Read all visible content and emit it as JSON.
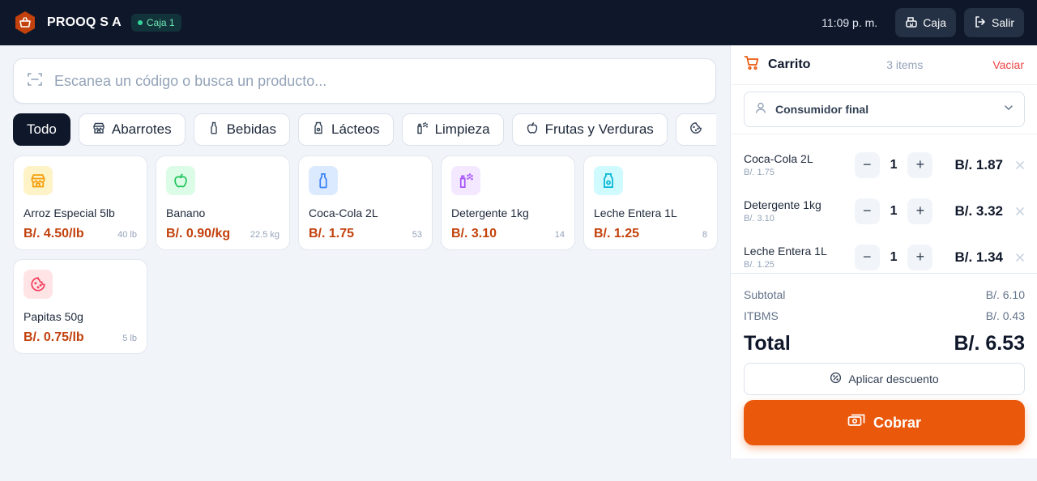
{
  "header": {
    "brand": "PROOQ S A",
    "register": "Caja 1",
    "time": "11:09 p. m.",
    "cash_label": "Caja",
    "logout_label": "Salir"
  },
  "search": {
    "placeholder": "Escanea un código o busca un producto..."
  },
  "categories": [
    {
      "label": "Todo",
      "icon": "none",
      "active": true
    },
    {
      "label": "Abarrotes",
      "icon": "store-icon"
    },
    {
      "label": "Bebidas",
      "icon": "bottle-icon"
    },
    {
      "label": "Lácteos",
      "icon": "milk-icon"
    },
    {
      "label": "Limpieza",
      "icon": "spray-icon"
    },
    {
      "label": "Frutas y Verduras",
      "icon": "apple-icon"
    },
    {
      "label": "",
      "icon": "cookie-icon"
    }
  ],
  "products": [
    {
      "name": "Arroz Especial 5lb",
      "price": "B/. 4.50/lb",
      "stock": "40 lb",
      "icon": "store-icon",
      "tint": "#fef3c7",
      "color": "#f59e0b"
    },
    {
      "name": "Banano",
      "price": "B/. 0.90/kg",
      "stock": "22.5 kg",
      "icon": "apple-icon",
      "tint": "#dcfce7",
      "color": "#22c55e"
    },
    {
      "name": "Coca-Cola 2L",
      "price": "B/. 1.75",
      "stock": "53",
      "icon": "bottle-icon",
      "tint": "#dbeafe",
      "color": "#3b82f6"
    },
    {
      "name": "Detergente 1kg",
      "price": "B/. 3.10",
      "stock": "14",
      "icon": "spray-icon",
      "tint": "#f3e8ff",
      "color": "#a855f7"
    },
    {
      "name": "Leche Entera 1L",
      "price": "B/. 1.25",
      "stock": "8",
      "icon": "milk-icon",
      "tint": "#cffafe",
      "color": "#06b6d4"
    },
    {
      "name": "Papitas 50g",
      "price": "B/. 0.75/lb",
      "stock": "5 lb",
      "icon": "cookie-icon",
      "tint": "#ffe4e6",
      "color": "#f43f5e"
    }
  ],
  "cart": {
    "title": "Carrito",
    "count": "3 items",
    "clear_label": "Vaciar",
    "customer": "Consumidor final",
    "items": [
      {
        "name": "Coca-Cola 2L",
        "unit": "B/. 1.75",
        "qty": "1",
        "total": "B/. 1.87"
      },
      {
        "name": "Detergente 1kg",
        "unit": "B/. 3.10",
        "qty": "1",
        "total": "B/. 3.32"
      },
      {
        "name": "Leche Entera 1L",
        "unit": "B/. 1.25",
        "qty": "1",
        "total": "B/. 1.34"
      }
    ],
    "subtotal_label": "Subtotal",
    "subtotal": "B/. 6.10",
    "tax_label": "ITBMS",
    "tax": "B/. 0.43",
    "total_label": "Total",
    "total": "B/. 6.53",
    "discount_label": "Aplicar descuento",
    "pay_label": "Cobrar"
  },
  "colors": {
    "accent": "#ea580c",
    "price": "#c2410c",
    "topbar": "#0f172a"
  }
}
